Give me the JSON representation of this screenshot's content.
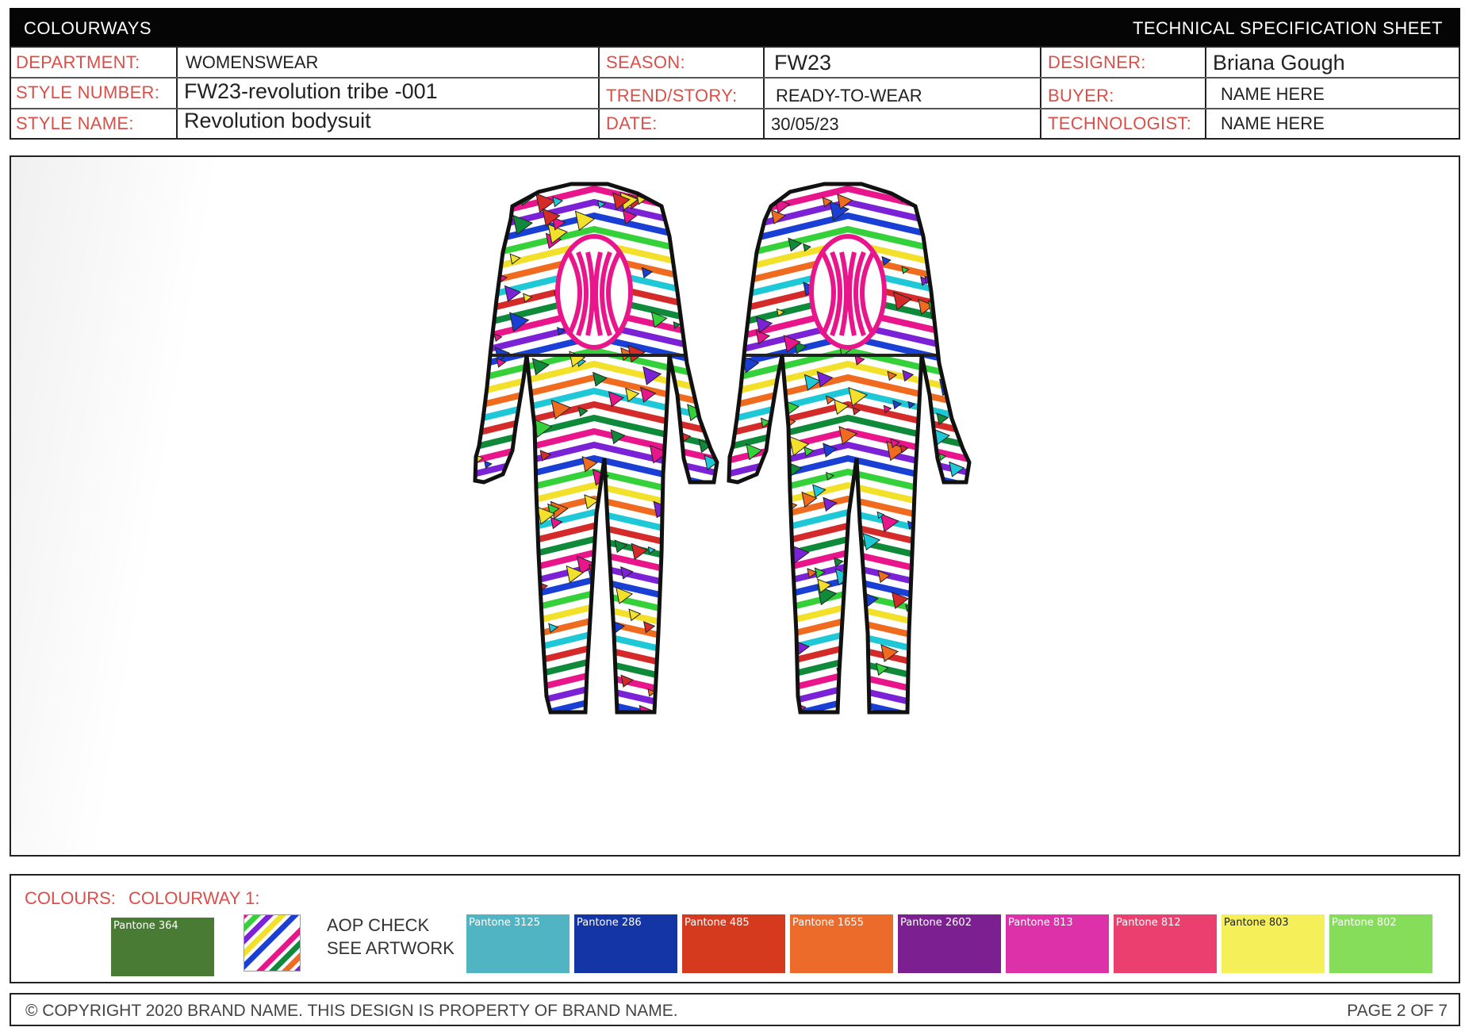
{
  "header": {
    "left_title": "COLOURWAYS",
    "right_title": "TECHNICAL SPECIFICATION SHEET"
  },
  "info": {
    "department_label": "DEPARTMENT:",
    "department": "WOMENSWEAR",
    "style_number_label": "STYLE NUMBER:",
    "style_number": "FW23-revolution tribe -001",
    "style_name_label": "STYLE NAME:",
    "style_name": "Revolution bodysuit",
    "season_label": "SEASON:",
    "season": "FW23",
    "trend_label": "TREND/STORY:",
    "trend": "READY-TO-WEAR",
    "date_label": "DATE:",
    "date": "30/05/23",
    "designer_label": "DESIGNER:",
    "designer": "Briana Gough",
    "buyer_label": "BUYER:",
    "buyer": "NAME HERE",
    "technologist_label": "TECHNOLOGIST:",
    "technologist": "NAME HERE"
  },
  "colours": {
    "label": "COLOURS:",
    "colourway": "COLOURWAY 1:",
    "aop_line1": "AOP CHECK",
    "aop_line2": "SEE ARTWORK",
    "swatches": [
      {
        "name": "Pantone 364",
        "hex": "#4a7b35",
        "text": "#ffffff"
      },
      {
        "name": "Pantone 3125",
        "hex": "#50b4c2",
        "text": "#ffffff"
      },
      {
        "name": "Pantone 286",
        "hex": "#1435a5",
        "text": "#ffffff"
      },
      {
        "name": "Pantone 485",
        "hex": "#d53a1f",
        "text": "#ffffff"
      },
      {
        "name": "Pantone 1655",
        "hex": "#ec6a2a",
        "text": "#ffffff"
      },
      {
        "name": "Pantone 2602",
        "hex": "#7c1f90",
        "text": "#ffffff"
      },
      {
        "name": "Pantone 813",
        "hex": "#dc31a8",
        "text": "#ffffff"
      },
      {
        "name": "Pantone 812",
        "hex": "#ea3f6f",
        "text": "#ffffff"
      },
      {
        "name": "Pantone 803",
        "hex": "#f5f05a",
        "text": "#222222"
      },
      {
        "name": "Pantone 802",
        "hex": "#86dd5a",
        "text": "#ffffff"
      }
    ]
  },
  "footer": {
    "copyright": "© COPYRIGHT 2020 BRAND NAME. THIS DESIGN IS PROPERTY OF BRAND NAME.",
    "page": "PAGE 2 OF 7"
  },
  "print_palette": [
    "#e8168a",
    "#7b21d6",
    "#1a3fd4",
    "#35d13a",
    "#f2e02b",
    "#ef6b1f",
    "#1ec8d6",
    "#d42a2a",
    "#0f8a3a",
    "#ffffff"
  ]
}
